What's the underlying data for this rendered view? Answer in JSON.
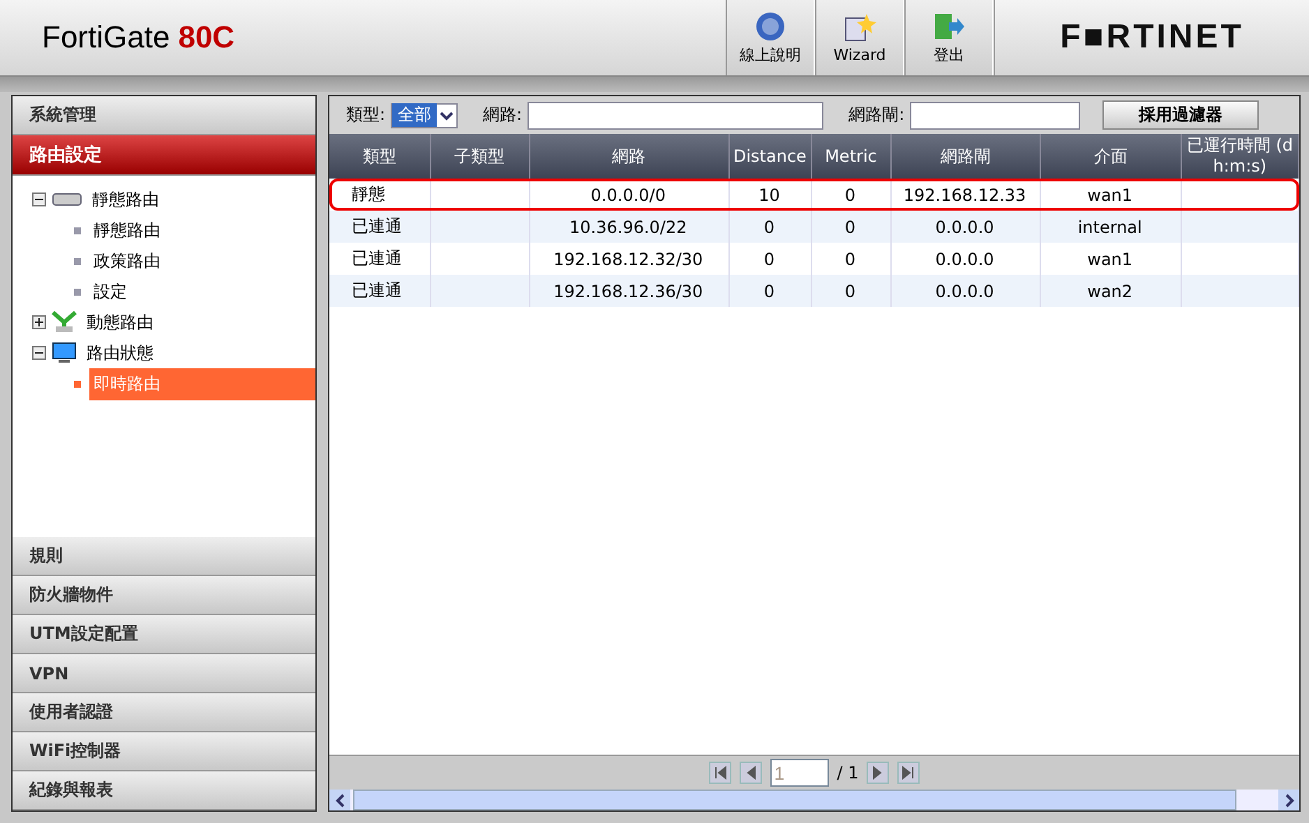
{
  "header": {
    "product": "FortiGate",
    "model": "80C",
    "buttons": [
      {
        "label": "線上說明",
        "kind": "help"
      },
      {
        "label": "Wizard",
        "kind": "wizard"
      },
      {
        "label": "登出",
        "kind": "logout"
      }
    ],
    "logo": "F■RTINET"
  },
  "sidebar": {
    "top_sections": [
      {
        "label": "系統管理",
        "selected": false
      },
      {
        "label": "路由設定",
        "selected": true
      }
    ],
    "tree": [
      {
        "label": "靜態路由",
        "kind": "router",
        "expanded": true,
        "selected": false,
        "children": [
          {
            "label": "靜態路由",
            "selected": false
          },
          {
            "label": "政策路由",
            "selected": false
          },
          {
            "label": "設定",
            "selected": false
          }
        ]
      },
      {
        "label": "動態路由",
        "kind": "network",
        "expanded": false,
        "selected": false
      },
      {
        "label": "路由狀態",
        "kind": "monitor",
        "expanded": true,
        "selected": false,
        "children": [
          {
            "label": "即時路由",
            "selected": true
          }
        ]
      }
    ],
    "bottom_sections": [
      {
        "label": "規則",
        "selected": false
      },
      {
        "label": "防火牆物件",
        "selected": false
      },
      {
        "label": "UTM設定配置",
        "selected": false
      },
      {
        "label": "VPN",
        "selected": false
      },
      {
        "label": "使用者認證",
        "selected": false
      },
      {
        "label": "WiFi控制器",
        "selected": false
      },
      {
        "label": "紀錄與報表",
        "selected": false
      }
    ]
  },
  "filter": {
    "type_label": "類型:",
    "type_value": "全部",
    "network_label": "網路:",
    "gateway_label": "網路閘:",
    "apply_button": "採用過濾器"
  },
  "table": {
    "columns": [
      "類型",
      "子類型",
      "網路",
      "Distance",
      "Metric",
      "網路閘",
      "介面",
      "已運行時間 (d h:m:s)"
    ],
    "rows": [
      {
        "cells": [
          "靜態",
          "",
          "0.0.0.0/0",
          "10",
          "0",
          "192.168.12.33",
          "wan1",
          ""
        ],
        "highlighted": true
      },
      {
        "cells": [
          "已連通",
          "",
          "10.36.96.0/22",
          "0",
          "0",
          "0.0.0.0",
          "internal",
          ""
        ],
        "highlighted": false
      },
      {
        "cells": [
          "已連通",
          "",
          "192.168.12.32/30",
          "0",
          "0",
          "0.0.0.0",
          "wan1",
          ""
        ],
        "highlighted": false
      },
      {
        "cells": [
          "已連通",
          "",
          "192.168.12.36/30",
          "0",
          "0",
          "0.0.0.0",
          "wan2",
          ""
        ],
        "highlighted": false
      }
    ]
  },
  "pager": {
    "page": "1",
    "total": "/ 1"
  }
}
